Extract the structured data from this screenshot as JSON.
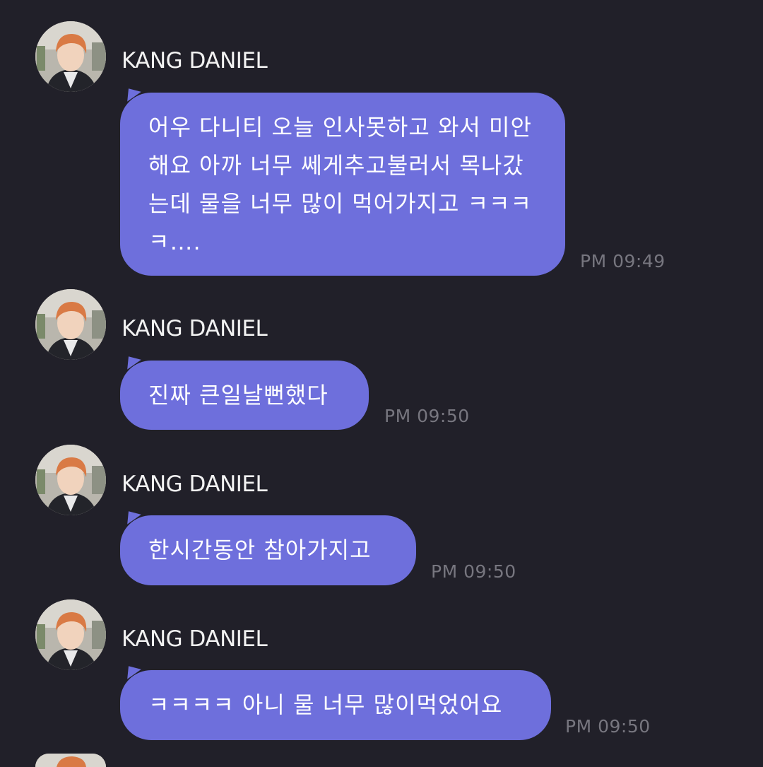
{
  "messages": [
    {
      "sender": "KANG DANIEL",
      "text": "어우 다니티 오늘 인사못하고 와서 미안해요 아까 너무 쎄게추고불러서 목나갔는데 물을 너무 많이 먹어가지고 ㅋㅋㅋㅋ….",
      "time": "PM 09:49",
      "avatar_icon": "profile-photo"
    },
    {
      "sender": "KANG DANIEL",
      "text": "진짜 큰일날뻔했다",
      "time": "PM 09:50",
      "avatar_icon": "profile-photo"
    },
    {
      "sender": "KANG DANIEL",
      "text": "한시간동안 참아가지고",
      "time": "PM 09:50",
      "avatar_icon": "profile-photo"
    },
    {
      "sender": "KANG DANIEL",
      "text": "ㅋㅋㅋㅋ 아니 물 너무 많이먹었어요",
      "time": "PM 09:50",
      "avatar_icon": "profile-photo"
    }
  ],
  "colors": {
    "background": "#212029",
    "bubble": "#6e6fdc",
    "timestamp": "#77767f",
    "sender": "#f2f2f2"
  }
}
